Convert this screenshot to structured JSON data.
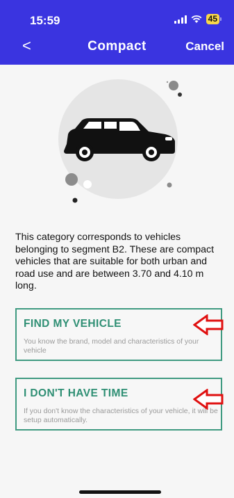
{
  "status_bar": {
    "time": "15:59",
    "battery": "45"
  },
  "nav": {
    "back_icon": "<",
    "title": "Compact",
    "cancel": "Cancel"
  },
  "illustration": {
    "icon": "compact-car-icon"
  },
  "description": "This category corresponds to vehicles belonging to segment B2. These are compact vehicles that are suitable for both urban and road use and are between 3.70 and 4.10 m long.",
  "options": [
    {
      "title": "FIND MY VEHICLE",
      "subtitle": "You know the brand, model and characteristics of your vehicle"
    },
    {
      "title": "I DON'T HAVE TIME",
      "subtitle": "If you don't know the characteristics of your vehicle, it will be setup automatically."
    }
  ],
  "colors": {
    "header": "#3a34e0",
    "accent": "#2f8f74",
    "arrow": "#e01010"
  }
}
